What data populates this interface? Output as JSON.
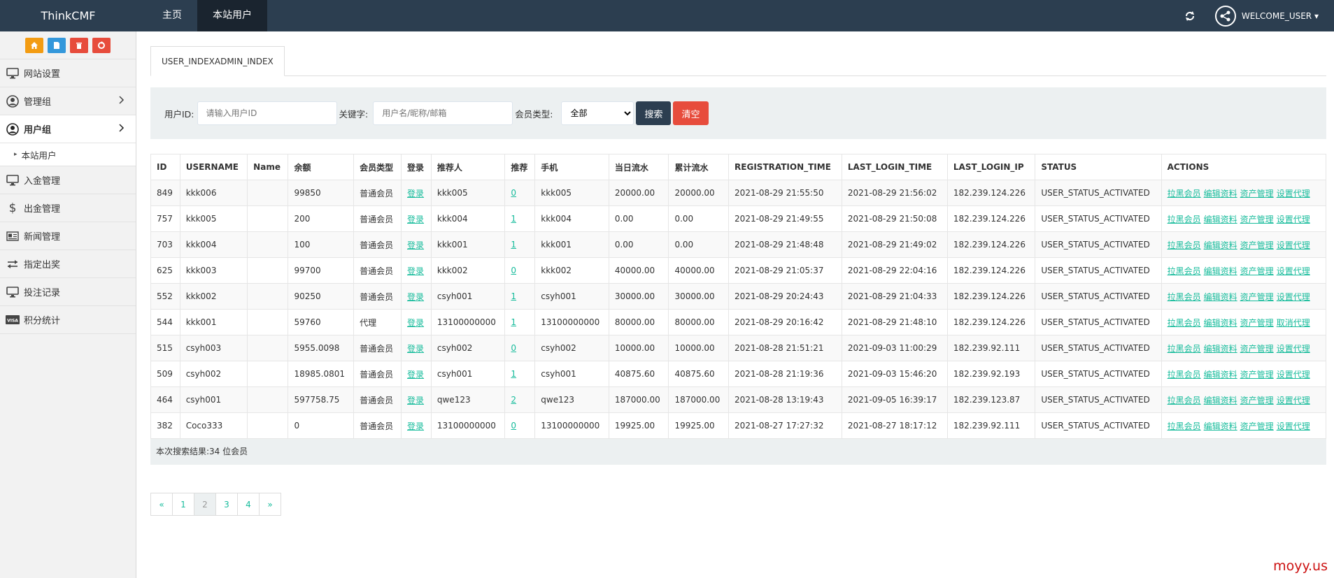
{
  "brand": "ThinkCMF",
  "topnav": [
    {
      "label": "主页",
      "active": false
    },
    {
      "label": "本站用户",
      "active": true
    }
  ],
  "user": {
    "welcome": "WELCOME_USER"
  },
  "sidebar": {
    "items": [
      {
        "label": "网站设置",
        "icon": "monitor-icon"
      },
      {
        "label": "管理组",
        "icon": "user-circle-icon"
      },
      {
        "label": "用户组",
        "icon": "user-circle-icon"
      },
      {
        "label": "入金管理",
        "icon": "monitor-icon"
      },
      {
        "label": "出金管理",
        "icon": "dollar-icon"
      },
      {
        "label": "新闻管理",
        "icon": "newspaper-icon"
      },
      {
        "label": "指定出奖",
        "icon": "exchange-icon"
      },
      {
        "label": "投注记录",
        "icon": "monitor-icon"
      },
      {
        "label": "积分统计",
        "icon": "visa-icon"
      }
    ],
    "subitem": "本站用户",
    "visa_text": "VISA"
  },
  "tab": {
    "label": "USER_INDEXADMIN_INDEX"
  },
  "search": {
    "id_label": "用户ID:",
    "id_placeholder": "请输入用户ID",
    "keyword_label": "关键字:",
    "keyword_placeholder": "用户名/昵称/邮箱",
    "type_label": "会员类型:",
    "type_value": "全部",
    "search_button": "搜索",
    "clear_button": "清空"
  },
  "table": {
    "columns": [
      "ID",
      "USERNAME",
      "Name",
      "余额",
      "会员类型",
      "登录",
      "推荐人",
      "推荐",
      "手机",
      "当日流水",
      "累计流水",
      "REGISTRATION_TIME",
      "LAST_LOGIN_TIME",
      "LAST_LOGIN_IP",
      "STATUS",
      "ACTIONS"
    ],
    "rows": [
      {
        "id": "849",
        "username": "kkk006",
        "name": "",
        "balance": "99850",
        "type": "普通会员",
        "login": "登录",
        "referrer": "kkk005",
        "ref_count": "0",
        "phone": "kkk005",
        "daily": "20000.00",
        "total": "20000.00",
        "reg_time": "2021-08-29 21:55:50",
        "last_login": "2021-08-29 21:56:02",
        "ip": "182.239.124.226",
        "status": "USER_STATUS_ACTIVATED",
        "a1": "拉黑会员",
        "a2": "编辑资料",
        "a3": "资产管理",
        "a4": "设置代理"
      },
      {
        "id": "757",
        "username": "kkk005",
        "name": "",
        "balance": "200",
        "type": "普通会员",
        "login": "登录",
        "referrer": "kkk004",
        "ref_count": "1",
        "phone": "kkk004",
        "daily": "0.00",
        "total": "0.00",
        "reg_time": "2021-08-29 21:49:55",
        "last_login": "2021-08-29 21:50:08",
        "ip": "182.239.124.226",
        "status": "USER_STATUS_ACTIVATED",
        "a1": "拉黑会员",
        "a2": "编辑资料",
        "a3": "资产管理",
        "a4": "设置代理"
      },
      {
        "id": "703",
        "username": "kkk004",
        "name": "",
        "balance": "100",
        "type": "普通会员",
        "login": "登录",
        "referrer": "kkk001",
        "ref_count": "1",
        "phone": "kkk001",
        "daily": "0.00",
        "total": "0.00",
        "reg_time": "2021-08-29 21:48:48",
        "last_login": "2021-08-29 21:49:02",
        "ip": "182.239.124.226",
        "status": "USER_STATUS_ACTIVATED",
        "a1": "拉黑会员",
        "a2": "编辑资料",
        "a3": "资产管理",
        "a4": "设置代理"
      },
      {
        "id": "625",
        "username": "kkk003",
        "name": "",
        "balance": "99700",
        "type": "普通会员",
        "login": "登录",
        "referrer": "kkk002",
        "ref_count": "0",
        "phone": "kkk002",
        "daily": "40000.00",
        "total": "40000.00",
        "reg_time": "2021-08-29 21:05:37",
        "last_login": "2021-08-29 22:04:16",
        "ip": "182.239.124.226",
        "status": "USER_STATUS_ACTIVATED",
        "a1": "拉黑会员",
        "a2": "编辑资料",
        "a3": "资产管理",
        "a4": "设置代理"
      },
      {
        "id": "552",
        "username": "kkk002",
        "name": "",
        "balance": "90250",
        "type": "普通会员",
        "login": "登录",
        "referrer": "csyh001",
        "ref_count": "1",
        "phone": "csyh001",
        "daily": "30000.00",
        "total": "30000.00",
        "reg_time": "2021-08-29 20:24:43",
        "last_login": "2021-08-29 21:04:33",
        "ip": "182.239.124.226",
        "status": "USER_STATUS_ACTIVATED",
        "a1": "拉黑会员",
        "a2": "编辑资料",
        "a3": "资产管理",
        "a4": "设置代理"
      },
      {
        "id": "544",
        "username": "kkk001",
        "name": "",
        "balance": "59760",
        "type": "代理",
        "login": "登录",
        "referrer": "13100000000",
        "ref_count": "1",
        "phone": "13100000000",
        "daily": "80000.00",
        "total": "80000.00",
        "reg_time": "2021-08-29 20:16:42",
        "last_login": "2021-08-29 21:48:10",
        "ip": "182.239.124.226",
        "status": "USER_STATUS_ACTIVATED",
        "a1": "拉黑会员",
        "a2": "编辑资料",
        "a3": "资产管理",
        "a4": "取消代理"
      },
      {
        "id": "515",
        "username": "csyh003",
        "name": "",
        "balance": "5955.0098",
        "type": "普通会员",
        "login": "登录",
        "referrer": "csyh002",
        "ref_count": "0",
        "phone": "csyh002",
        "daily": "10000.00",
        "total": "10000.00",
        "reg_time": "2021-08-28 21:51:21",
        "last_login": "2021-09-03 11:00:29",
        "ip": "182.239.92.111",
        "status": "USER_STATUS_ACTIVATED",
        "a1": "拉黑会员",
        "a2": "编辑资料",
        "a3": "资产管理",
        "a4": "设置代理"
      },
      {
        "id": "509",
        "username": "csyh002",
        "name": "",
        "balance": "18985.0801",
        "type": "普通会员",
        "login": "登录",
        "referrer": "csyh001",
        "ref_count": "1",
        "phone": "csyh001",
        "daily": "40875.60",
        "total": "40875.60",
        "reg_time": "2021-08-28 21:19:36",
        "last_login": "2021-09-03 15:46:20",
        "ip": "182.239.92.193",
        "status": "USER_STATUS_ACTIVATED",
        "a1": "拉黑会员",
        "a2": "编辑资料",
        "a3": "资产管理",
        "a4": "设置代理"
      },
      {
        "id": "464",
        "username": "csyh001",
        "name": "",
        "balance": "597758.75",
        "type": "普通会员",
        "login": "登录",
        "referrer": "qwe123",
        "ref_count": "2",
        "phone": "qwe123",
        "daily": "187000.00",
        "total": "187000.00",
        "reg_time": "2021-08-28 13:19:43",
        "last_login": "2021-09-05 16:39:17",
        "ip": "182.239.123.87",
        "status": "USER_STATUS_ACTIVATED",
        "a1": "拉黑会员",
        "a2": "编辑资料",
        "a3": "资产管理",
        "a4": "设置代理"
      },
      {
        "id": "382",
        "username": "Coco333",
        "name": "",
        "balance": "0",
        "type": "普通会员",
        "login": "登录",
        "referrer": "13100000000",
        "ref_count": "0",
        "phone": "13100000000",
        "daily": "19925.00",
        "total": "19925.00",
        "reg_time": "2021-08-27 17:27:32",
        "last_login": "2021-08-27 18:17:12",
        "ip": "182.239.92.111",
        "status": "USER_STATUS_ACTIVATED",
        "a1": "拉黑会员",
        "a2": "编辑资料",
        "a3": "资产管理",
        "a4": "设置代理"
      }
    ],
    "result_text": "本次搜索结果:34 位会员"
  },
  "pagination": [
    "«",
    "1",
    "2",
    "3",
    "4",
    "»"
  ],
  "pagination_current": "2",
  "watermark": "moyy.us",
  "colors": {
    "topbar": "#2c3e50",
    "link": "#18bc9c",
    "danger": "#e74c3c",
    "warning": "#f39c12",
    "info": "#3498db"
  }
}
